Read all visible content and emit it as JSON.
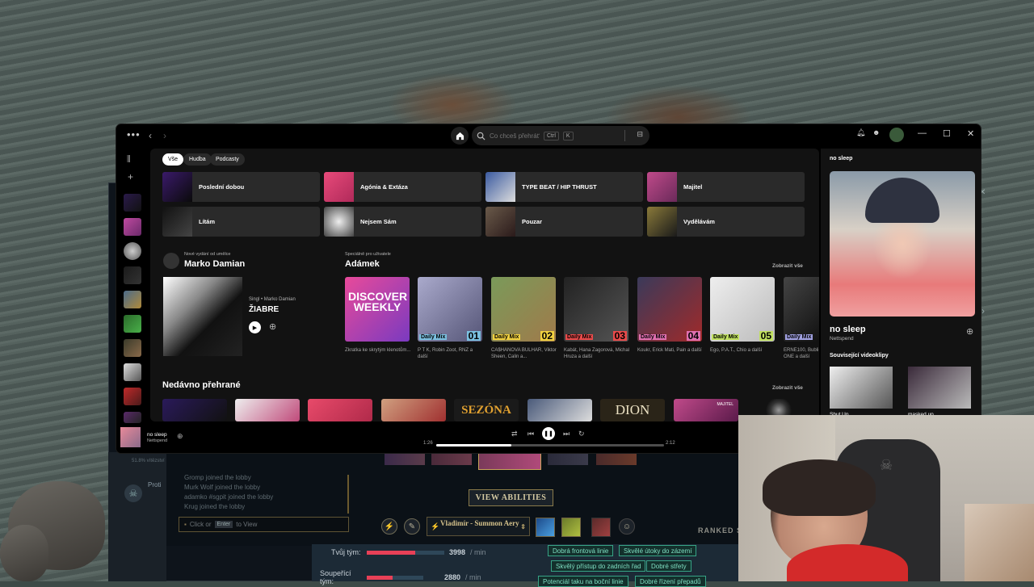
{
  "spotify": {
    "search_placeholder": "Co chceš přehrát?",
    "kbd1": "Ctrl",
    "kbd2": "K",
    "filters": [
      "Vše",
      "Hudba",
      "Podcasty"
    ],
    "quick": [
      "Poslední dobou",
      "Agónia & Extáza",
      "TYPE BEAT / HIP THRUST",
      "Majitel",
      "Lítám",
      "Nejsem Sám",
      "Pouzar",
      "Vydělávám"
    ],
    "release": {
      "sub": "Nové vydání od umělce",
      "artist": "Marko Damian",
      "meta": "Singl • Marko Damian",
      "title": "ŽIABRE"
    },
    "madefor": {
      "sub": "Speciálně pro uživatele",
      "title": "Adámek",
      "show_all": "Zobrazit vše"
    },
    "cards": [
      {
        "label": "",
        "num": "",
        "art_title": "DISCOVER WEEKLY",
        "desc": "Zkratka ke skrytým klenotům..."
      },
      {
        "label": "Daily Mix",
        "num": "01",
        "desc": "P T K, Robin Zoot, RNZ a další"
      },
      {
        "label": "Daily Mix",
        "num": "02",
        "desc": "CA$HANOVA BULHAR, Viktor Sheen, Calin a..."
      },
      {
        "label": "Daily Mix",
        "num": "03",
        "desc": "Kabát, Hana Zagorová, Michal Hruza a další"
      },
      {
        "label": "Daily Mix",
        "num": "04",
        "desc": "Koukr, Erick Mati, Pain a další"
      },
      {
        "label": "Daily Mix",
        "num": "05",
        "desc": "Ego, P.A.T., Chio a další"
      },
      {
        "label": "Daily Mix",
        "num": "",
        "desc": "ERNE100, Bubli ONE a další"
      }
    ],
    "recent": {
      "title": "Nedávno přehrané",
      "show_all": "Zobrazit vše",
      "sezona": "SEZÓNA",
      "dion": "DION",
      "majitel": "MAJITEL"
    },
    "now_playing": {
      "header": "no sleep",
      "title": "no sleep",
      "artist": "Nettspend",
      "related": "Související videoklipy",
      "clip1": "Shut Up",
      "clip2": "masked up"
    },
    "player": {
      "title": "no sleep",
      "artist": "Nettspend",
      "elapsed": "1:26",
      "total": "2:12",
      "progress": 0.33
    }
  },
  "game": {
    "chat": [
      "Gromp joined the lobby",
      "Murk Wolf joined the lobby",
      "adamko #sgpit joined the lobby",
      "Krug joined the lobby"
    ],
    "chat_placeholder_pre": "Click or",
    "chat_key": "Enter",
    "chat_placeholder_post": "to View",
    "view_abilities": "VIEW ABILITIES",
    "skin": "Vladimír - Summon Aery",
    "ranked": "RANKED S",
    "side_text": "Proti",
    "side_pct": "51.8% vítězství",
    "stats": [
      {
        "label": "Tvůj tým:",
        "value": "3998",
        "unit": "/ min",
        "fill": 0.62,
        "color": "#e84057"
      },
      {
        "label": "Soupeřící tým:",
        "value": "2880",
        "unit": "/ min",
        "fill": 0.45,
        "color": "#e84057"
      }
    ],
    "honors": [
      "Dobrá frontová linie",
      "Skvělé útoky do zázemí",
      "Skvělý přístup do zadních řad",
      "Dobré střety",
      "Potenciál taku na boční linie",
      "Dobré řízení přepadů"
    ]
  }
}
